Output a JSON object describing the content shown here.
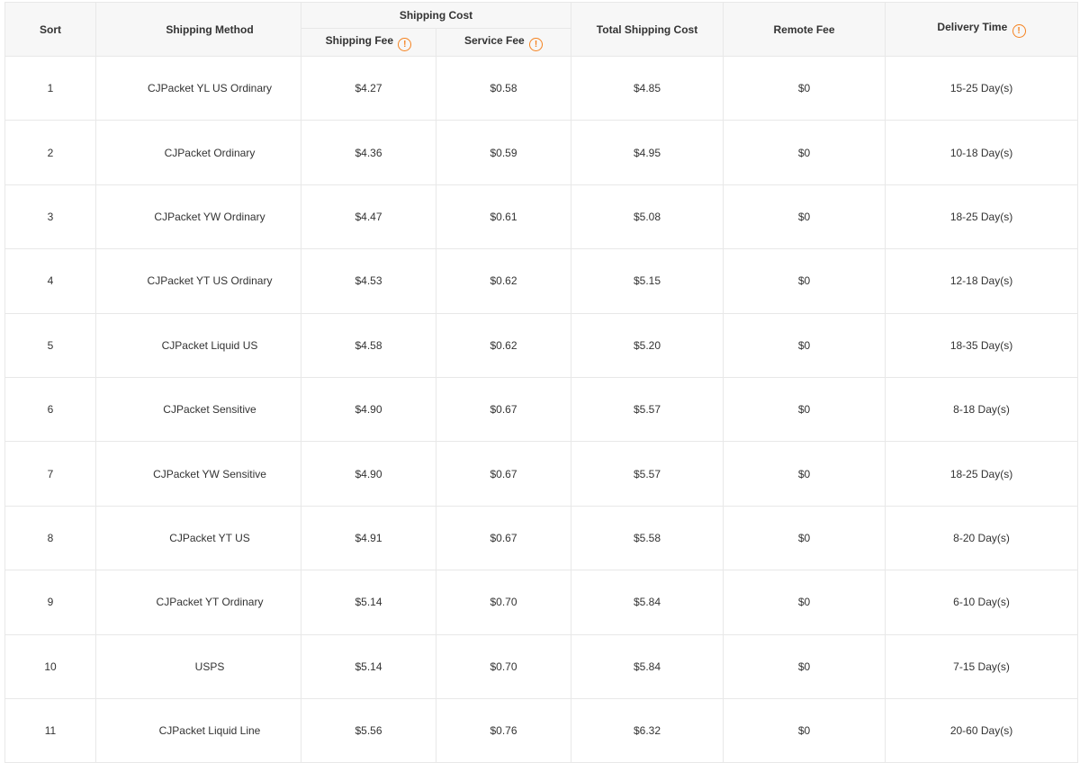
{
  "header": {
    "sort": "Sort",
    "method": "Shipping Method",
    "shipping_cost": "Shipping Cost",
    "shipping_fee": "Shipping Fee",
    "service_fee": "Service Fee",
    "total": "Total Shipping Cost",
    "remote_fee": "Remote Fee",
    "delivery": "Delivery Time",
    "info_glyph": "!"
  },
  "accent_color": "#f5821f",
  "rows": [
    {
      "sort": "1",
      "method": "CJPacket YL US Ordinary",
      "shipping_fee": "$4.27",
      "service_fee": "$0.58",
      "total": "$4.85",
      "remote": "$0",
      "delivery": "15-25 Day(s)"
    },
    {
      "sort": "2",
      "method": "CJPacket Ordinary",
      "shipping_fee": "$4.36",
      "service_fee": "$0.59",
      "total": "$4.95",
      "remote": "$0",
      "delivery": "10-18 Day(s)"
    },
    {
      "sort": "3",
      "method": "CJPacket YW Ordinary",
      "shipping_fee": "$4.47",
      "service_fee": "$0.61",
      "total": "$5.08",
      "remote": "$0",
      "delivery": "18-25 Day(s)"
    },
    {
      "sort": "4",
      "method": "CJPacket YT US Ordinary",
      "shipping_fee": "$4.53",
      "service_fee": "$0.62",
      "total": "$5.15",
      "remote": "$0",
      "delivery": "12-18 Day(s)"
    },
    {
      "sort": "5",
      "method": "CJPacket Liquid US",
      "shipping_fee": "$4.58",
      "service_fee": "$0.62",
      "total": "$5.20",
      "remote": "$0",
      "delivery": "18-35 Day(s)"
    },
    {
      "sort": "6",
      "method": "CJPacket Sensitive",
      "shipping_fee": "$4.90",
      "service_fee": "$0.67",
      "total": "$5.57",
      "remote": "$0",
      "delivery": "8-18 Day(s)"
    },
    {
      "sort": "7",
      "method": "CJPacket YW Sensitive",
      "shipping_fee": "$4.90",
      "service_fee": "$0.67",
      "total": "$5.57",
      "remote": "$0",
      "delivery": "18-25 Day(s)"
    },
    {
      "sort": "8",
      "method": "CJPacket YT US",
      "shipping_fee": "$4.91",
      "service_fee": "$0.67",
      "total": "$5.58",
      "remote": "$0",
      "delivery": "8-20 Day(s)"
    },
    {
      "sort": "9",
      "method": "CJPacket YT Ordinary",
      "shipping_fee": "$5.14",
      "service_fee": "$0.70",
      "total": "$5.84",
      "remote": "$0",
      "delivery": "6-10 Day(s)"
    },
    {
      "sort": "10",
      "method": "USPS",
      "shipping_fee": "$5.14",
      "service_fee": "$0.70",
      "total": "$5.84",
      "remote": "$0",
      "delivery": "7-15 Day(s)"
    },
    {
      "sort": "11",
      "method": "CJPacket Liquid Line",
      "shipping_fee": "$5.56",
      "service_fee": "$0.76",
      "total": "$6.32",
      "remote": "$0",
      "delivery": "20-60 Day(s)"
    }
  ]
}
